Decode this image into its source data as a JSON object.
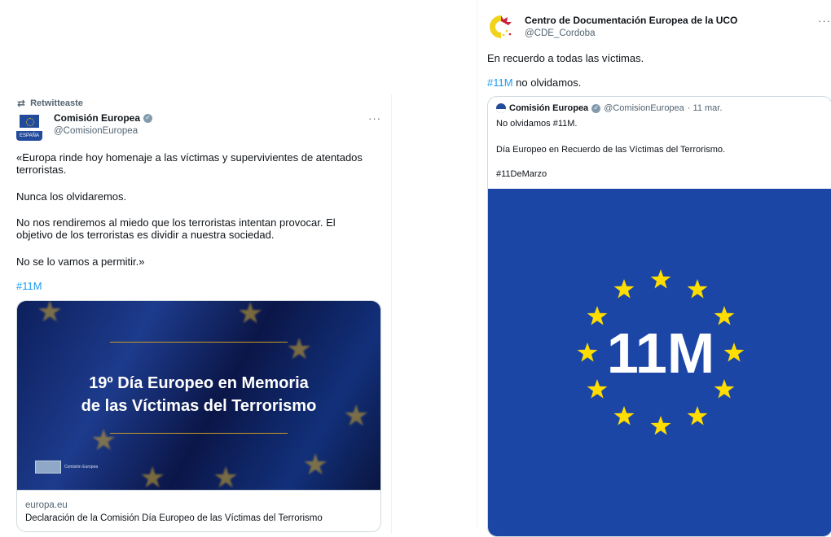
{
  "left_tweet": {
    "retweet_label": "Retwitteaste",
    "author_name": "Comisión Europea",
    "author_handle": "@ComisionEuropea",
    "avatar_text": "ESPAÑA",
    "more_label": "···",
    "text_paragraph_1": "«Europa rinde hoy homenaje a las víctimas y supervivientes de atentados terroristas.",
    "text_paragraph_2": "Nunca los olvidaremos.",
    "text_paragraph_3": "No nos rendiremos al miedo que los terroristas intentan provocar. El objetivo de los terroristas es dividir a nuestra sociedad.",
    "text_paragraph_4": "No se lo vamos a permitir.»",
    "hashtag": "#11M",
    "card": {
      "title_line_1": "19º Día Europeo en Memoria",
      "title_line_2": "de las Víctimas del Terrorismo",
      "logo_text": "Comisión Europea",
      "domain": "europa.eu",
      "description": "Declaración de la Comisión Día Europeo de las Víctimas del Terrorismo"
    }
  },
  "right_tweet": {
    "author_name": "Centro de Documentación Europea de la UCO",
    "author_handle": "@CDE_Cordoba",
    "more_label": "···",
    "text_line_1": "En recuerdo a todas las víctimas.",
    "hashtag": "#11M",
    "text_line_2_rest": " no olvidamos.",
    "quote": {
      "author_name": "Comisión Europea",
      "author_handle": "@ComisionEuropea",
      "date": "· 11 mar.",
      "line_1": "No olvidamos #11M.",
      "line_2": "Día Europeo en Recuerdo de las Víctimas del Terrorismo.",
      "line_3": "#11DeMarzo",
      "image_text": "11M"
    }
  },
  "colors": {
    "link_blue": "#1d9bf0",
    "eu_blue": "#1c46a6",
    "eu_yellow": "#ffdd00",
    "secondary_text": "#536471"
  },
  "icons": [
    "retweet-icon",
    "verified-badge-icon",
    "more-options-icon",
    "eu-star-icon"
  ]
}
